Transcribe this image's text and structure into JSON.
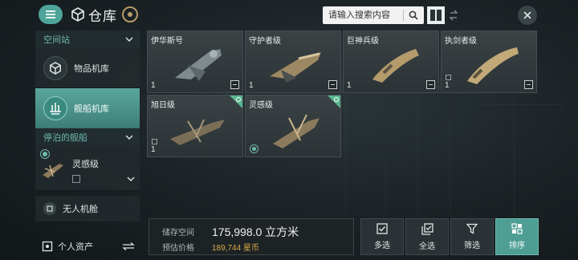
{
  "header": {
    "title": "仓库",
    "search_placeholder": "请输入搜索内容"
  },
  "sidebar": {
    "section_station": "空间站",
    "items": [
      {
        "label": "物品机库",
        "icon": "cube-icon"
      },
      {
        "label": "舰船机库",
        "icon": "ship-hangar-icon",
        "active": true
      }
    ],
    "section_docked": "停泊的舰船",
    "docked_ship": {
      "name": "灵感级"
    },
    "drone_bay": "无人机舱",
    "personal_assets": "个人资产"
  },
  "ships": [
    {
      "name": "伊华斯号",
      "qty": "1"
    },
    {
      "name": "守护者级",
      "qty": "1"
    },
    {
      "name": "巨神兵级",
      "qty": "1"
    },
    {
      "name": "执剑者级",
      "qty": "1"
    },
    {
      "name": "旭日级",
      "qty": "1"
    },
    {
      "name": "灵感级",
      "qty": ""
    }
  ],
  "storage": {
    "label_space": "储存空间",
    "space_value": "175,998.0 立方米",
    "label_price": "预估价格",
    "price_value": "189,744 星币"
  },
  "actions": [
    "多选",
    "全选",
    "筛选",
    "排序"
  ],
  "colors": {
    "accent": "#4e9e94",
    "price": "#d9a94a",
    "fitted": "#5ab48f"
  }
}
